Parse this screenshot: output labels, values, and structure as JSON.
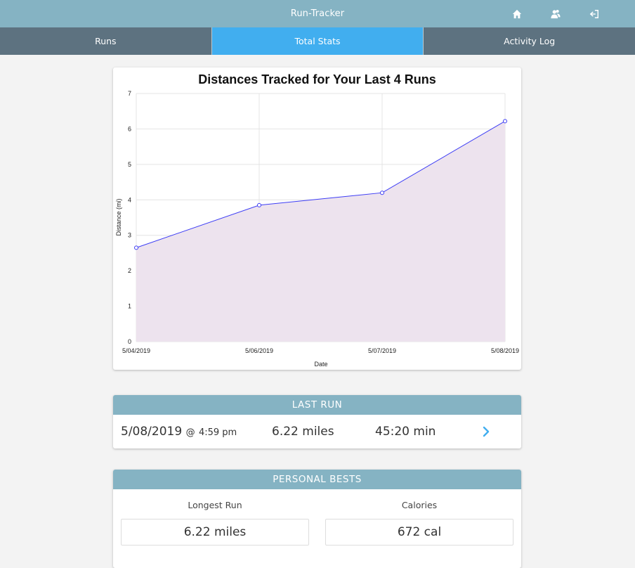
{
  "app": {
    "title": "Run-Tracker"
  },
  "header_icons": [
    "home-icon",
    "users-icon",
    "logout-icon"
  ],
  "tabs": [
    {
      "label": "Runs",
      "active": false
    },
    {
      "label": "Total Stats",
      "active": true
    },
    {
      "label": "Activity Log",
      "active": false
    }
  ],
  "chart_data": {
    "type": "area",
    "title": "Distances Tracked for Your Last 4 Runs",
    "xlabel": "Date",
    "ylabel": "Distance (mi)",
    "categories": [
      "5/04/2019",
      "5/06/2019",
      "5/07/2019",
      "5/08/2019"
    ],
    "series": [
      {
        "values": [
          2.65,
          3.85,
          4.2,
          6.22
        ],
        "line_color": "#3d3df5",
        "fill_color": "#ede3ee"
      }
    ],
    "y_ticks": [
      0,
      1,
      2,
      3,
      4,
      5,
      6,
      7
    ],
    "ylim": [
      0,
      7
    ],
    "grid": true
  },
  "last_run": {
    "header": "LAST RUN",
    "date": "5/08/2019",
    "time_prefix": "@",
    "time": "4:59 pm",
    "distance": "6.22 miles",
    "duration": "45:20 min"
  },
  "personal_bests": {
    "header": "PERSONAL BESTS",
    "longest_run_label": "Longest Run",
    "longest_run_value": "6.22 miles",
    "calories_label": "Calories",
    "calories_value": "672 cal"
  },
  "colors": {
    "header_bg": "#85b3c3",
    "tabs_bg": "#5d7280",
    "active_tab": "#41aeef",
    "chevron": "#41aeef"
  }
}
